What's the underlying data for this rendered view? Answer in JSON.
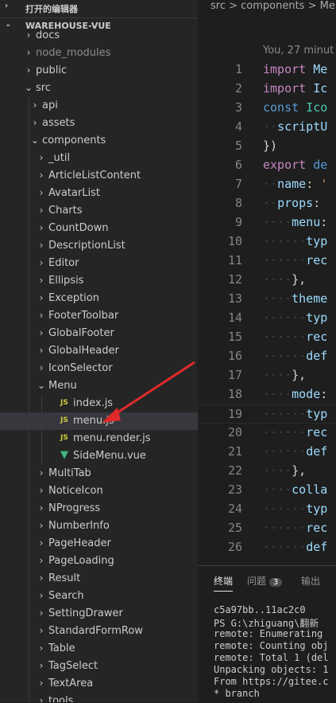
{
  "sidebar": {
    "open_editors": "打开的编辑器",
    "project": "WAREHOUSE-VUE",
    "items": [
      {
        "label": "docs",
        "level": 1,
        "chev": "›"
      },
      {
        "label": "node_modules",
        "level": 1,
        "chev": "›",
        "dim": true
      },
      {
        "label": "public",
        "level": 1,
        "chev": "›"
      },
      {
        "label": "src",
        "level": 1,
        "chev": "⌄"
      },
      {
        "label": "api",
        "level": 2,
        "chev": "›"
      },
      {
        "label": "assets",
        "level": 2,
        "chev": "›"
      },
      {
        "label": "components",
        "level": 2,
        "chev": "⌄"
      },
      {
        "label": "_util",
        "level": 3,
        "chev": "›"
      },
      {
        "label": "ArticleListContent",
        "level": 3,
        "chev": "›"
      },
      {
        "label": "AvatarList",
        "level": 3,
        "chev": "›"
      },
      {
        "label": "Charts",
        "level": 3,
        "chev": "›"
      },
      {
        "label": "CountDown",
        "level": 3,
        "chev": "›"
      },
      {
        "label": "DescriptionList",
        "level": 3,
        "chev": "›"
      },
      {
        "label": "Editor",
        "level": 3,
        "chev": "›"
      },
      {
        "label": "Ellipsis",
        "level": 3,
        "chev": "›"
      },
      {
        "label": "Exception",
        "level": 3,
        "chev": "›"
      },
      {
        "label": "FooterToolbar",
        "level": 3,
        "chev": "›"
      },
      {
        "label": "GlobalFooter",
        "level": 3,
        "chev": "›"
      },
      {
        "label": "GlobalHeader",
        "level": 3,
        "chev": "›"
      },
      {
        "label": "IconSelector",
        "level": 3,
        "chev": "›"
      },
      {
        "label": "Menu",
        "level": 3,
        "chev": "⌄"
      },
      {
        "label": "index.js",
        "level": 4,
        "icon": "js"
      },
      {
        "label": "menu.js",
        "level": 4,
        "icon": "js",
        "selected": true
      },
      {
        "label": "menu.render.js",
        "level": 4,
        "icon": "js"
      },
      {
        "label": "SideMenu.vue",
        "level": 4,
        "icon": "vue"
      },
      {
        "label": "MultiTab",
        "level": 3,
        "chev": "›"
      },
      {
        "label": "NoticeIcon",
        "level": 3,
        "chev": "›"
      },
      {
        "label": "NProgress",
        "level": 3,
        "chev": "›"
      },
      {
        "label": "NumberInfo",
        "level": 3,
        "chev": "›"
      },
      {
        "label": "PageHeader",
        "level": 3,
        "chev": "›"
      },
      {
        "label": "PageLoading",
        "level": 3,
        "chev": "›"
      },
      {
        "label": "Result",
        "level": 3,
        "chev": "›"
      },
      {
        "label": "Search",
        "level": 3,
        "chev": "›"
      },
      {
        "label": "SettingDrawer",
        "level": 3,
        "chev": "›"
      },
      {
        "label": "StandardFormRow",
        "level": 3,
        "chev": "›"
      },
      {
        "label": "Table",
        "level": 3,
        "chev": "›"
      },
      {
        "label": "TagSelect",
        "level": 3,
        "chev": "›"
      },
      {
        "label": "TextArea",
        "level": 3,
        "chev": "›"
      },
      {
        "label": "tools",
        "level": 3,
        "chev": "›"
      }
    ]
  },
  "editor": {
    "breadcrumb": "src > components > Menu",
    "blame": "You, 27 minut",
    "lines": [
      {
        "n": "1",
        "parts": [
          [
            "kw2",
            "import "
          ],
          [
            "id",
            "Me"
          ]
        ]
      },
      {
        "n": "2",
        "parts": [
          [
            "kw2",
            "import "
          ],
          [
            "id",
            "Ic"
          ]
        ]
      },
      {
        "n": "3",
        "parts": [
          [
            "kw",
            "const "
          ],
          [
            "cls",
            "Ico"
          ]
        ]
      },
      {
        "n": "4",
        "parts": [
          [
            "dots",
            "··"
          ],
          [
            "id",
            "scriptU"
          ]
        ]
      },
      {
        "n": "5",
        "parts": [
          [
            "punc",
            "})"
          ]
        ]
      },
      {
        "n": "6",
        "parts": [
          [
            "kw2",
            "export "
          ],
          [
            "kw",
            "de"
          ]
        ]
      },
      {
        "n": "7",
        "parts": [
          [
            "dots",
            "··"
          ],
          [
            "id",
            "name"
          ],
          [
            "punc",
            ": "
          ],
          [
            "str",
            "'"
          ]
        ]
      },
      {
        "n": "8",
        "parts": [
          [
            "dots",
            "··"
          ],
          [
            "id",
            "props"
          ],
          [
            "punc",
            ": "
          ]
        ]
      },
      {
        "n": "9",
        "parts": [
          [
            "dots",
            "····"
          ],
          [
            "id",
            "menu"
          ],
          [
            "punc",
            ":"
          ]
        ]
      },
      {
        "n": "10",
        "parts": [
          [
            "dots",
            "······"
          ],
          [
            "id",
            "typ"
          ]
        ]
      },
      {
        "n": "11",
        "parts": [
          [
            "dots",
            "······"
          ],
          [
            "id",
            "rec"
          ]
        ]
      },
      {
        "n": "12",
        "parts": [
          [
            "dots",
            "····"
          ],
          [
            "punc",
            "},"
          ]
        ]
      },
      {
        "n": "13",
        "parts": [
          [
            "dots",
            "····"
          ],
          [
            "id",
            "theme"
          ]
        ]
      },
      {
        "n": "14",
        "parts": [
          [
            "dots",
            "······"
          ],
          [
            "id",
            "typ"
          ]
        ]
      },
      {
        "n": "15",
        "parts": [
          [
            "dots",
            "······"
          ],
          [
            "id",
            "rec"
          ]
        ]
      },
      {
        "n": "16",
        "parts": [
          [
            "dots",
            "······"
          ],
          [
            "id",
            "def"
          ]
        ]
      },
      {
        "n": "17",
        "parts": [
          [
            "dots",
            "····"
          ],
          [
            "punc",
            "},"
          ]
        ]
      },
      {
        "n": "18",
        "parts": [
          [
            "dots",
            "····"
          ],
          [
            "id",
            "mode"
          ],
          [
            "punc",
            ":"
          ]
        ]
      },
      {
        "n": "19",
        "parts": [
          [
            "dots",
            "······"
          ],
          [
            "id",
            "typ"
          ]
        ],
        "cur": true
      },
      {
        "n": "20",
        "parts": [
          [
            "dots",
            "······"
          ],
          [
            "id",
            "rec"
          ]
        ]
      },
      {
        "n": "21",
        "parts": [
          [
            "dots",
            "······"
          ],
          [
            "id",
            "def"
          ]
        ]
      },
      {
        "n": "22",
        "parts": [
          [
            "dots",
            "····"
          ],
          [
            "punc",
            "},"
          ]
        ]
      },
      {
        "n": "23",
        "parts": [
          [
            "dots",
            "····"
          ],
          [
            "id",
            "colla"
          ]
        ]
      },
      {
        "n": "24",
        "parts": [
          [
            "dots",
            "······"
          ],
          [
            "id",
            "typ"
          ]
        ]
      },
      {
        "n": "25",
        "parts": [
          [
            "dots",
            "······"
          ],
          [
            "id",
            "rec"
          ]
        ]
      },
      {
        "n": "26",
        "parts": [
          [
            "dots",
            "······"
          ],
          [
            "id",
            "def"
          ]
        ]
      }
    ]
  },
  "panel": {
    "tabs": {
      "terminal": "终端",
      "problems": "问题",
      "problems_count": "3",
      "output": "输出"
    },
    "terminal_lines": [
      "  c5a97bb..11ac2c0",
      "PS G:\\zhiguang\\翻新",
      "remote: Enumerating",
      "remote: Counting obj",
      "remote: Total 1 (del",
      "Unpacking objects: 1",
      "From https://gitee.c",
      " * branch"
    ]
  },
  "colors": {
    "accent": "#e02a2a",
    "selected": "#37373d",
    "js": "#cbcb41",
    "vue": "#41b883"
  }
}
